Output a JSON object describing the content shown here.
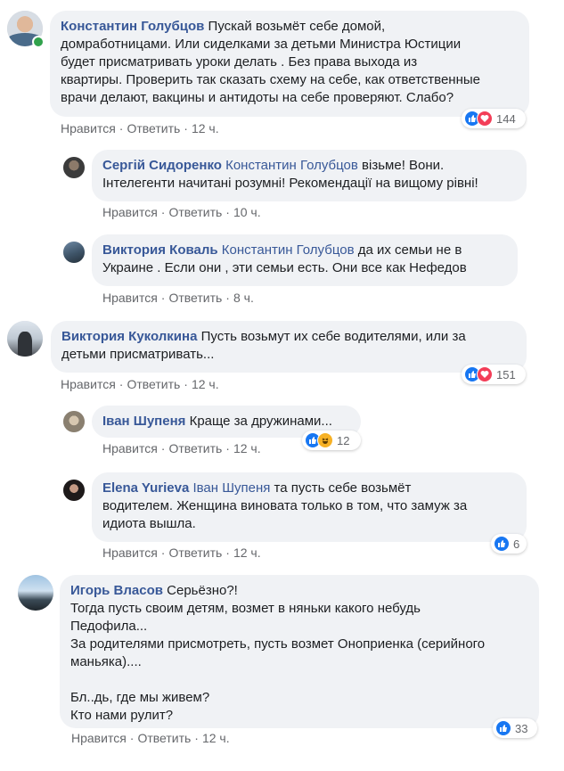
{
  "colors": {
    "bubble_bg": "#f0f2f5",
    "author": "#385898",
    "meta": "#65676b",
    "like": "#1877f2",
    "love": "#f33e58",
    "haha": "#f7b125",
    "online": "#31a24c"
  },
  "action_labels": {
    "like": "Нравится",
    "reply": "Ответить",
    "dot": "·"
  },
  "comments": [
    {
      "author": "Константин Голубцов",
      "mention": "",
      "lines": [
        "Пускай возьмёт себе домой,",
        "домработницами. Или сиделками за детьми Министра Юстиции",
        "будет присматривать уроки делать . Без права выхода из",
        "квартиры. Проверить так сказать схему на себе, как ответственные",
        "врачи делают, вакцины и антидоты на себе проверяют. Слабо?"
      ],
      "time": "12 ч.",
      "reactions": {
        "icons": [
          "like-icon",
          "love-icon"
        ],
        "count": "144"
      }
    },
    {
      "author": "Сергій Сидоренко",
      "mention": "Константин Голубцов",
      "lines": [
        "візьме! Вони.",
        "Інтелегенти начитані розумні! Рекомендації на вищому рівні!"
      ],
      "time": "10 ч.",
      "reactions": null
    },
    {
      "author": "Виктория Коваль",
      "mention": "Константин Голубцов",
      "lines": [
        "да их семьи не в",
        "Украине . Если они , эти семьи есть. Они все как Нефедов"
      ],
      "time": "8 ч.",
      "reactions": null
    },
    {
      "author": "Виктория Куколкина",
      "mention": "",
      "lines": [
        "Пусть возьмут их себе водителями, или за",
        "детьми присматривать..."
      ],
      "time": "12 ч.",
      "reactions": {
        "icons": [
          "like-icon",
          "love-icon"
        ],
        "count": "151"
      }
    },
    {
      "author": "Іван Шупеня",
      "mention": "",
      "lines": [
        "Краще за дружинами..."
      ],
      "time": "12 ч.",
      "reactions": {
        "icons": [
          "like-icon",
          "haha-icon"
        ],
        "count": "12"
      }
    },
    {
      "author": "Elena Yurieva",
      "mention": "Іван Шупеня",
      "lines": [
        "та пусть себе возьмёт",
        "водителем. Женщина виновата только в том, что замуж за",
        "идиота вышла."
      ],
      "time": "12 ч.",
      "reactions": {
        "icons": [
          "like-icon"
        ],
        "count": "6"
      }
    },
    {
      "author": "Игорь Власов",
      "mention": "",
      "lines": [
        "Серьёзно?!",
        "Тогда пусть своим детям, возмет в няньки какого небудь",
        "Педофила...",
        "За родителями присмотреть, пусть возмет Оноприенка (серийного",
        "маньяка)....",
        "",
        "Бл..дь, где мы живем?",
        "Кто нами рулит?"
      ],
      "time": "12 ч.",
      "reactions": {
        "icons": [
          "like-icon"
        ],
        "count": "33"
      }
    }
  ]
}
